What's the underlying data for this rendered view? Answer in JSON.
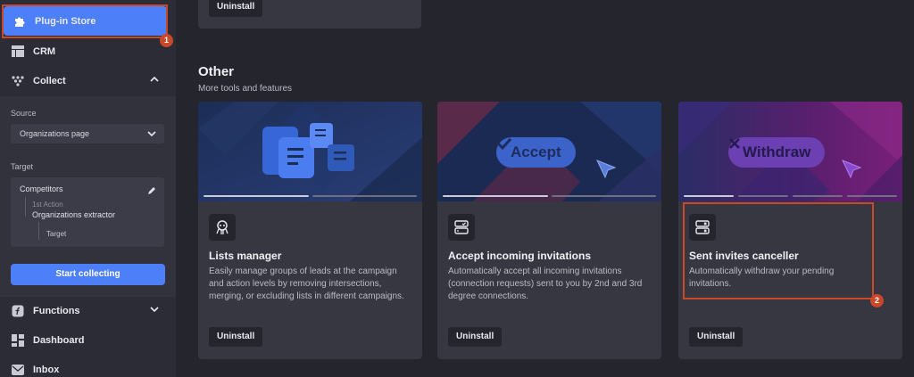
{
  "sidebar": {
    "plugin_store": "Plug-in Store",
    "crm": "CRM",
    "collect": "Collect",
    "source_label": "Source",
    "source_value": "Organizations page",
    "target_label": "Target",
    "target_box": {
      "name": "Competitors",
      "action": "1st Action",
      "extractor": "Organizations extractor",
      "target": "Target"
    },
    "start_button": "Start collecting",
    "functions": "Functions",
    "dashboard": "Dashboard",
    "inbox": "Inbox"
  },
  "main": {
    "top_uninstall": "Uninstall",
    "section_title": "Other",
    "section_subtitle": "More tools and features",
    "cards": [
      {
        "title": "Lists manager",
        "description": "Easily manage groups of leads at the campaign and action levels by removing intersections, merging, or excluding lists in different campaigns.",
        "button": "Uninstall",
        "icon": "octopus-icon"
      },
      {
        "title": "Accept incoming invitations",
        "description": "Automatically accept all incoming invitations (connection requests) sent to you by 2nd and 3rd degree connections.",
        "button": "Uninstall",
        "banner_label": "Accept",
        "icon": "server-check-icon"
      },
      {
        "title": "Sent invites canceller",
        "description": "Automatically withdraw your pending invitations.",
        "button": "Uninstall",
        "banner_label": "Withdraw",
        "icon": "server-x-icon"
      }
    ]
  },
  "annotations": {
    "badge1": "1",
    "badge2": "2"
  },
  "colors": {
    "accent": "#4d7ff8",
    "highlight": "#c9482a",
    "background": "#24252d",
    "card": "#363741"
  }
}
